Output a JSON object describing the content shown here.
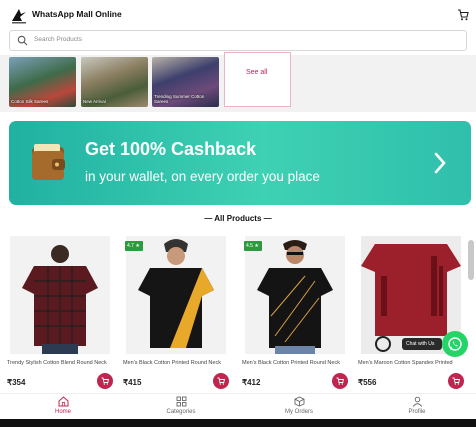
{
  "header": {
    "title": "WhatsApp Mall Online",
    "logo_icon": "bird-logo-icon",
    "cart_icon": "cart-icon"
  },
  "search": {
    "placeholder": "Search Products"
  },
  "categories": [
    {
      "label": "Cotton Silk Sarees"
    },
    {
      "label": "New Arrival"
    },
    {
      "label": "Trending Summer Cotton Sarees"
    }
  ],
  "see_all": "See all",
  "banner": {
    "title": "Get 100% Cashback",
    "subtitle": "in your wallet, on every order you place"
  },
  "section": {
    "title": "All Products"
  },
  "products": [
    {
      "name": "Trendy Stylish Cotton Blend Round Neck",
      "price": "₹354",
      "rating": ""
    },
    {
      "name": "Men's Black Cotton Printed Round Neck",
      "price": "₹415",
      "rating": "4.7 ★"
    },
    {
      "name": "Men's Black Cotton Printed Round Neck",
      "price": "₹412",
      "rating": "4.5 ★"
    },
    {
      "name": "Men's Maroon Cotton Spandex Printed",
      "price": "₹556",
      "rating": ""
    }
  ],
  "chat": {
    "label": "Chat with Us"
  },
  "nav": [
    {
      "label": "Home",
      "icon": "home-icon"
    },
    {
      "label": "Categories",
      "icon": "grid-icon"
    },
    {
      "label": "My Orders",
      "icon": "box-icon"
    },
    {
      "label": "Profile",
      "icon": "user-icon"
    }
  ],
  "colors": {
    "accent": "#c0254f",
    "banner": "#2fbfac",
    "whatsapp": "#25d366",
    "rating": "#2d9a3d"
  }
}
